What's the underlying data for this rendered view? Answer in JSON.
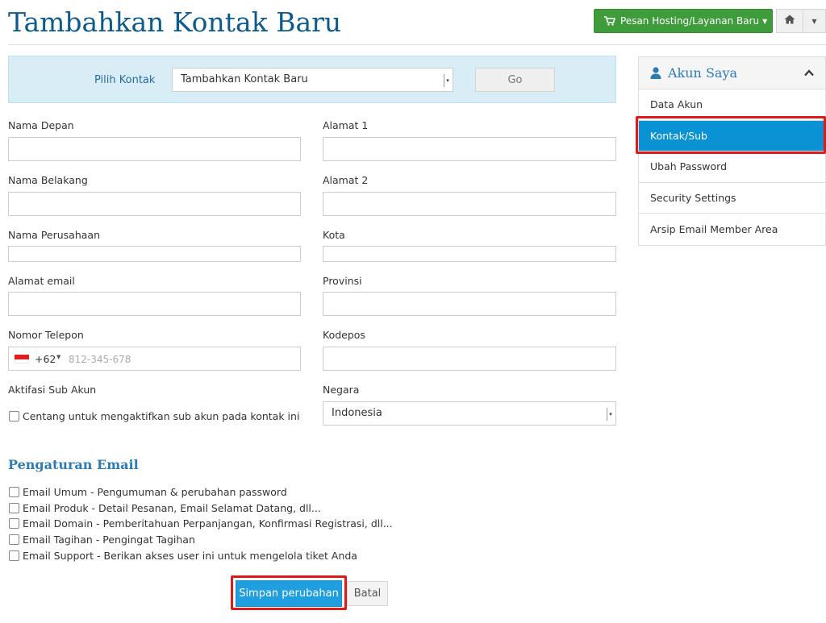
{
  "page": {
    "title": "Tambahkan Kontak Baru"
  },
  "header": {
    "order_label": "Pesan Hosting/Layanan Baru"
  },
  "contact_picker": {
    "label": "Pilih Kontak",
    "selected": "Tambahkan Kontak Baru",
    "go_label": "Go"
  },
  "form": {
    "first_name_label": "Nama Depan",
    "last_name_label": "Nama Belakang",
    "company_label": "Nama Perusahaan",
    "email_label": "Alamat email",
    "phone_label": "Nomor Telepon",
    "phone_code": "+62",
    "phone_placeholder": "812-345-678",
    "subaccount_label": "Aktifasi Sub Akun",
    "subaccount_checkbox": "Centang untuk mengaktifkan sub akun pada kontak ini",
    "address1_label": "Alamat 1",
    "address2_label": "Alamat 2",
    "city_label": "Kota",
    "state_label": "Provinsi",
    "postcode_label": "Kodepos",
    "country_label": "Negara",
    "country_selected": "Indonesia"
  },
  "email_settings": {
    "title": "Pengaturan Email",
    "options": [
      "Email Umum - Pengumuman & perubahan password",
      "Email Produk - Detail Pesanan, Email Selamat Datang, dll...",
      "Email Domain - Pemberitahuan Perpanjangan, Konfirmasi Registrasi, dll...",
      "Email Tagihan - Pengingat Tagihan",
      "Email Support - Berikan akses user ini untuk mengelola tiket Anda"
    ]
  },
  "actions": {
    "save_label": "Simpan perubahan",
    "cancel_label": "Batal"
  },
  "sidebar": {
    "title": "Akun Saya",
    "items": [
      {
        "label": "Data Akun"
      },
      {
        "label": "Kontak/Sub"
      },
      {
        "label": "Ubah Password"
      },
      {
        "label": "Security Settings"
      },
      {
        "label": "Arsip Email Member Area"
      }
    ],
    "active_index": 1
  },
  "colors": {
    "title": "#0d5b8c",
    "order_button": "#3e9c3b",
    "primary": "#1f9ee0",
    "highlight": "#e01a1a",
    "info_bar": "#d9edf7"
  }
}
